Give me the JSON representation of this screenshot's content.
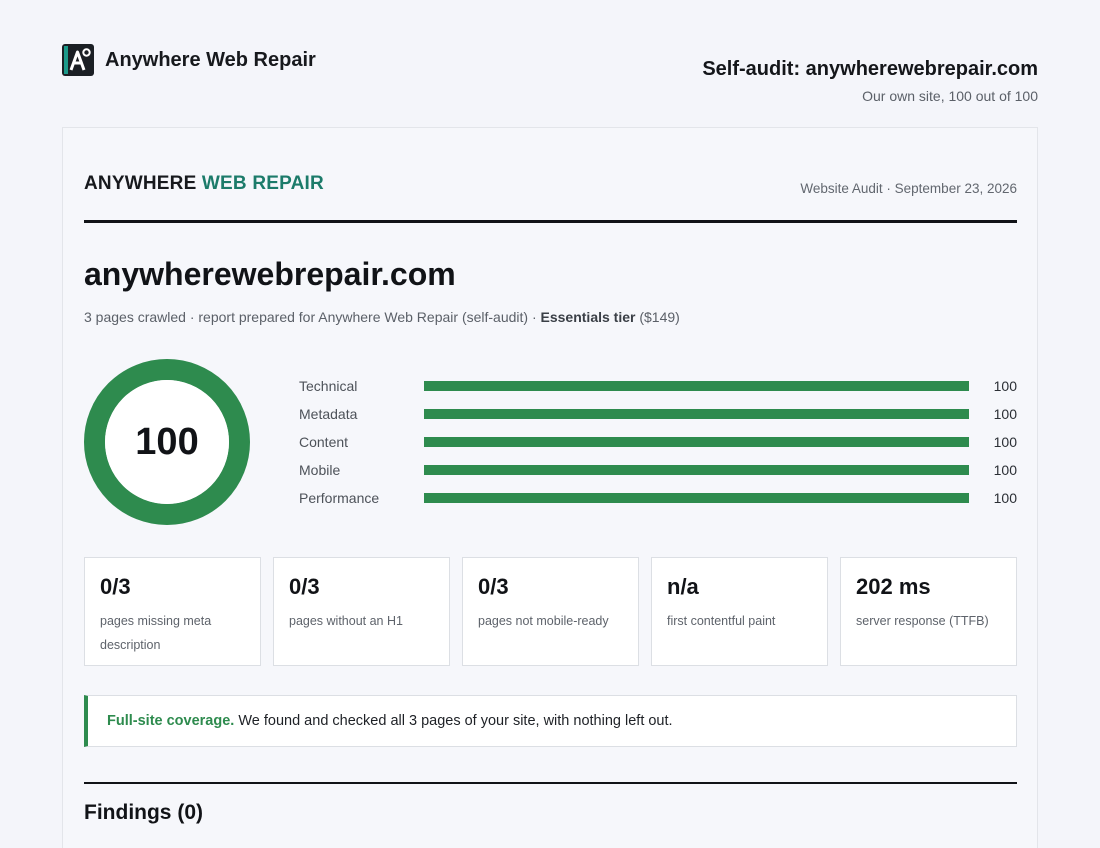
{
  "header": {
    "brand_name": "Anywhere Web Repair",
    "audit_title": "Self-audit: anywherewebrepair.com",
    "audit_subtitle": "Our own site, 100 out of 100"
  },
  "report": {
    "brand_part1": "ANYWHERE",
    "brand_part2": "WEB REPAIR",
    "meta": "Website Audit · September 23, 2026",
    "domain": "anywherewebrepair.com",
    "crawl_text": "3 pages crawled · report prepared for Anywhere Web Repair (self-audit) · ",
    "tier_label": "Essentials tier",
    "tier_price": " ($149)",
    "overall_score": "100",
    "overall_score_value": 100,
    "categories": [
      {
        "label": "Technical",
        "score": 100,
        "display": "100"
      },
      {
        "label": "Metadata",
        "score": 100,
        "display": "100"
      },
      {
        "label": "Content",
        "score": 100,
        "display": "100"
      },
      {
        "label": "Mobile",
        "score": 100,
        "display": "100"
      },
      {
        "label": "Performance",
        "score": 100,
        "display": "100"
      }
    ],
    "stats": [
      {
        "value": "0/3",
        "desc": "pages missing meta description"
      },
      {
        "value": "0/3",
        "desc": "pages without an H1"
      },
      {
        "value": "0/3",
        "desc": "pages not mobile-ready"
      },
      {
        "value": "n/a",
        "desc": "first contentful paint"
      },
      {
        "value": "202 ms",
        "desc": "server response (TTFB)"
      }
    ],
    "coverage_strong": "Full-site coverage.",
    "coverage_text": " We found and checked all 3 pages of your site, with nothing left out.",
    "findings_title": "Findings (0)"
  },
  "colors": {
    "accent_green": "#2e8b4e",
    "brand_teal": "#1c7b6a"
  }
}
